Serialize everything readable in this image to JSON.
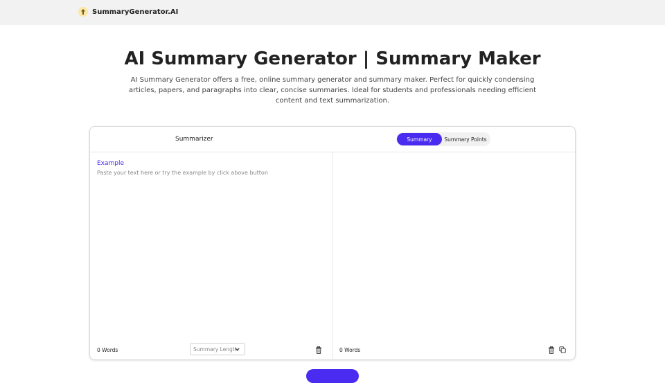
{
  "header": {
    "brand_name": "SummaryGenerator.AI",
    "logo_icon": "upload-arrow-icon"
  },
  "hero": {
    "title": "AI Summary Generator | Summary Maker",
    "description": "AI Summary Generator offers a free, online summary generator and summary maker. Perfect for quickly condensing articles, papers, and paragraphs into clear, concise summaries. Ideal for students and professionals needing efficient content and text summarization."
  },
  "tool": {
    "summarizer_label": "Summarizer",
    "mode_tabs": [
      {
        "label": "Summary",
        "active": true
      },
      {
        "label": "Summary Points",
        "active": false
      }
    ],
    "input": {
      "example_link": "Example",
      "placeholder": "Paste your text here or try the example by click above button",
      "word_count": "0 Words",
      "length_select_placeholder": "Summary Length"
    },
    "output": {
      "word_count": "0 Words"
    }
  },
  "colors": {
    "accent": "#4a2cf0",
    "topbar_bg": "#f2f2f2"
  }
}
